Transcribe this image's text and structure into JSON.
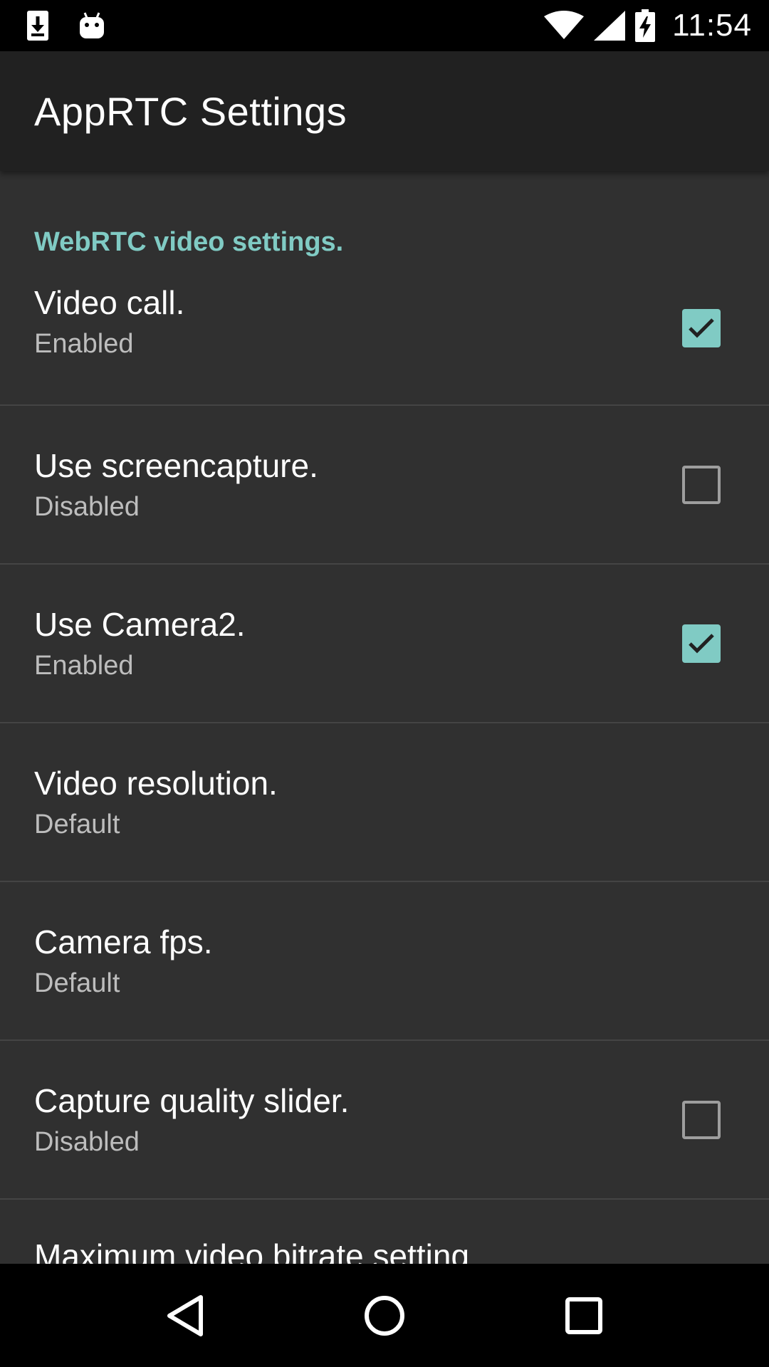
{
  "status_bar": {
    "time": "11:54",
    "left_icons": [
      "download-icon",
      "android-icon"
    ],
    "right_icons": [
      "wifi-icon",
      "cell-signal-icon",
      "battery-charging-icon"
    ]
  },
  "app_bar": {
    "title": "AppRTC Settings"
  },
  "settings": {
    "category": "WebRTC video settings.",
    "items": [
      {
        "title": "Video call.",
        "summary": "Enabled",
        "type": "checkbox",
        "checked": true
      },
      {
        "title": "Use screencapture.",
        "summary": "Disabled",
        "type": "checkbox",
        "checked": false
      },
      {
        "title": "Use Camera2.",
        "summary": "Enabled",
        "type": "checkbox",
        "checked": true
      },
      {
        "title": "Video resolution.",
        "summary": "Default",
        "type": "list"
      },
      {
        "title": "Camera fps.",
        "summary": "Default",
        "type": "list"
      },
      {
        "title": "Capture quality slider.",
        "summary": "Disabled",
        "type": "checkbox",
        "checked": false
      },
      {
        "title": "Maximum video bitrate setting.",
        "summary": "",
        "type": "list"
      }
    ]
  },
  "nav_bar": {
    "buttons": [
      "back-icon",
      "home-icon",
      "recents-icon"
    ]
  },
  "colors": {
    "accent": "#80cbc4",
    "background": "#303030",
    "app_bar": "#212121",
    "status_bar": "#000000"
  }
}
